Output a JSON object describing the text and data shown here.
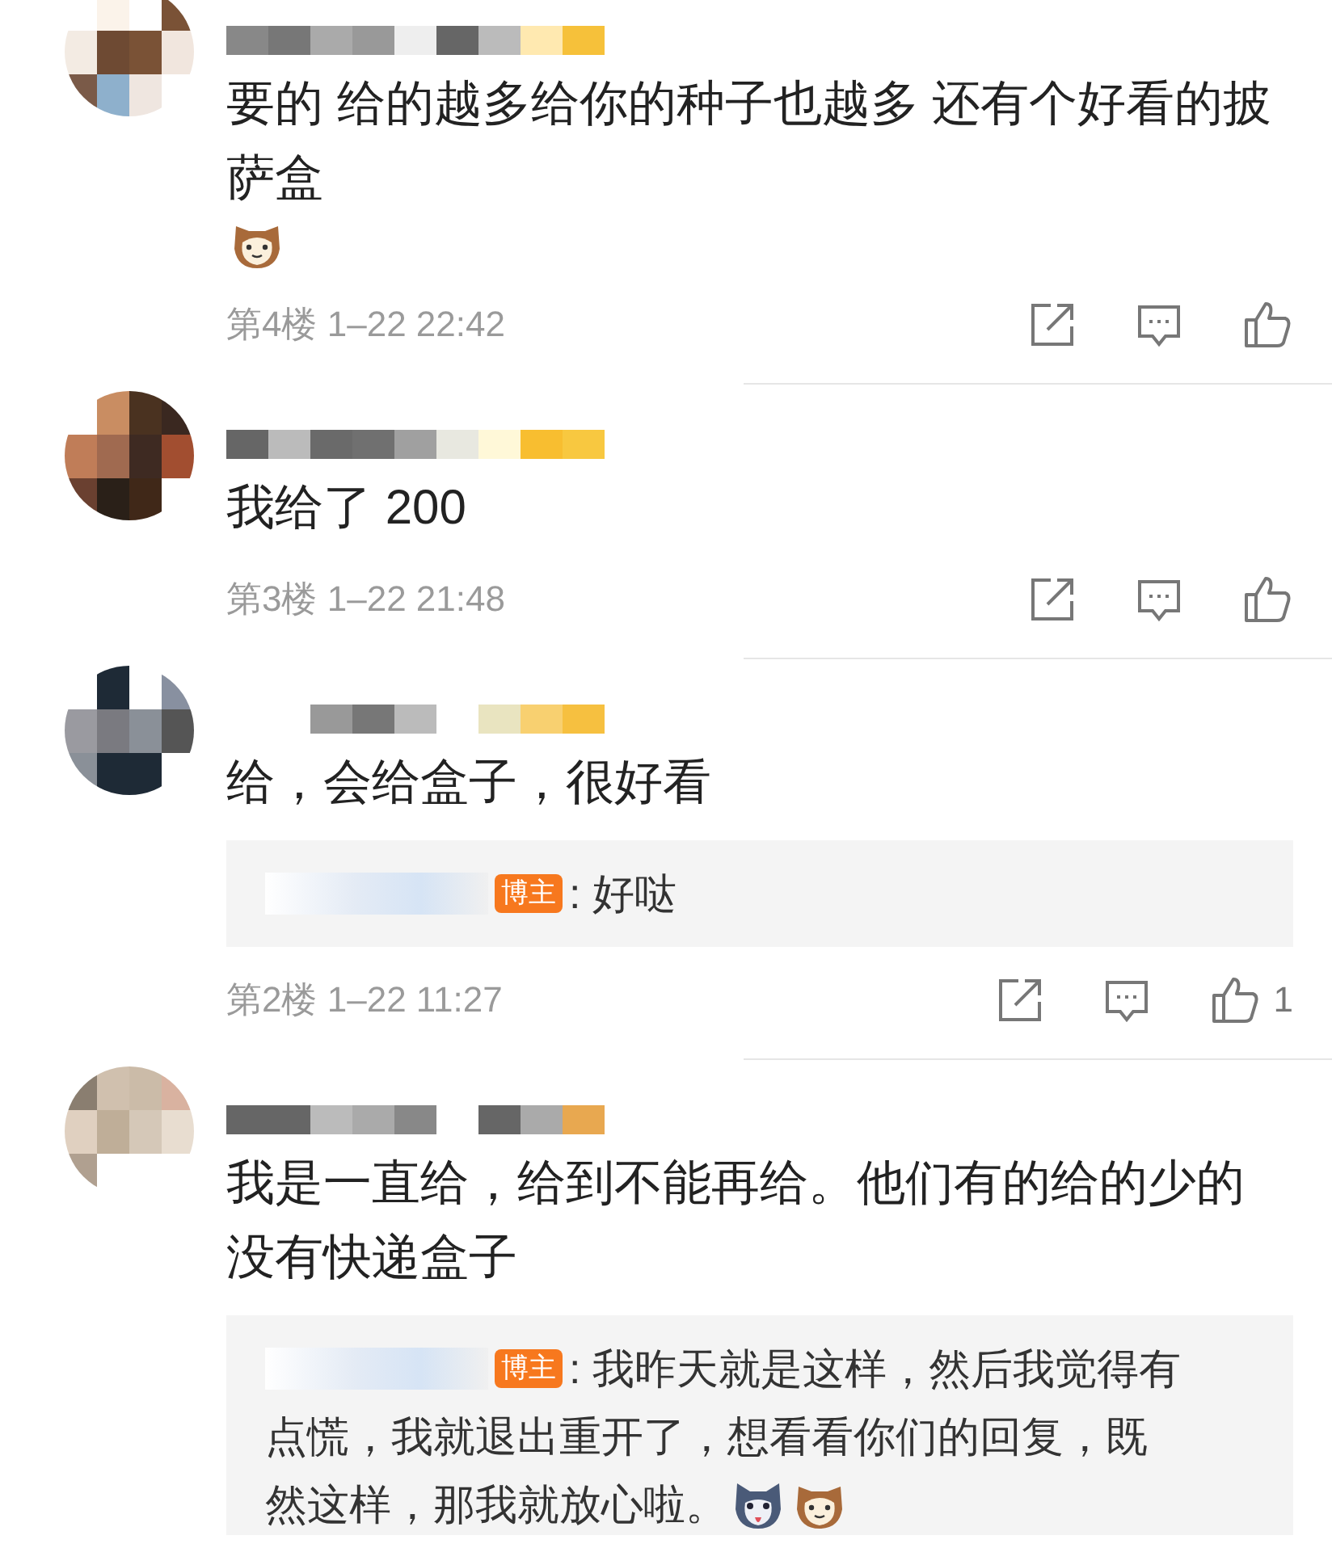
{
  "comments": [
    {
      "text": "要的 给的越多给你的种子也越多 还有个好看的披萨盒",
      "emojis": [
        {
          "kind": "cat"
        }
      ],
      "floor": "第4楼",
      "time": "1–22 22:42"
    },
    {
      "text": "我给了 200",
      "floor": "第3楼",
      "time": "1–22 21:48"
    },
    {
      "text": "给，会给盒子，很好看",
      "floor": "第2楼",
      "time": "1–22 11:27",
      "likes": "1",
      "replies": [
        {
          "badge": "博主",
          "lines": [
            ": 好哒"
          ]
        }
      ]
    },
    {
      "text": "我是一直给，给到不能再给。他们有的给的少的没有快递盒子",
      "replies": [
        {
          "badge": "博主",
          "lines": [
            ": 我昨天就是这样，然后我觉得有",
            "点慌，我就退出重开了，想看看你们的回复，既",
            "然这样，那我就放心啦。"
          ],
          "emojis": [
            {
              "kind": "dog"
            },
            {
              "kind": "cat"
            }
          ]
        }
      ]
    }
  ]
}
